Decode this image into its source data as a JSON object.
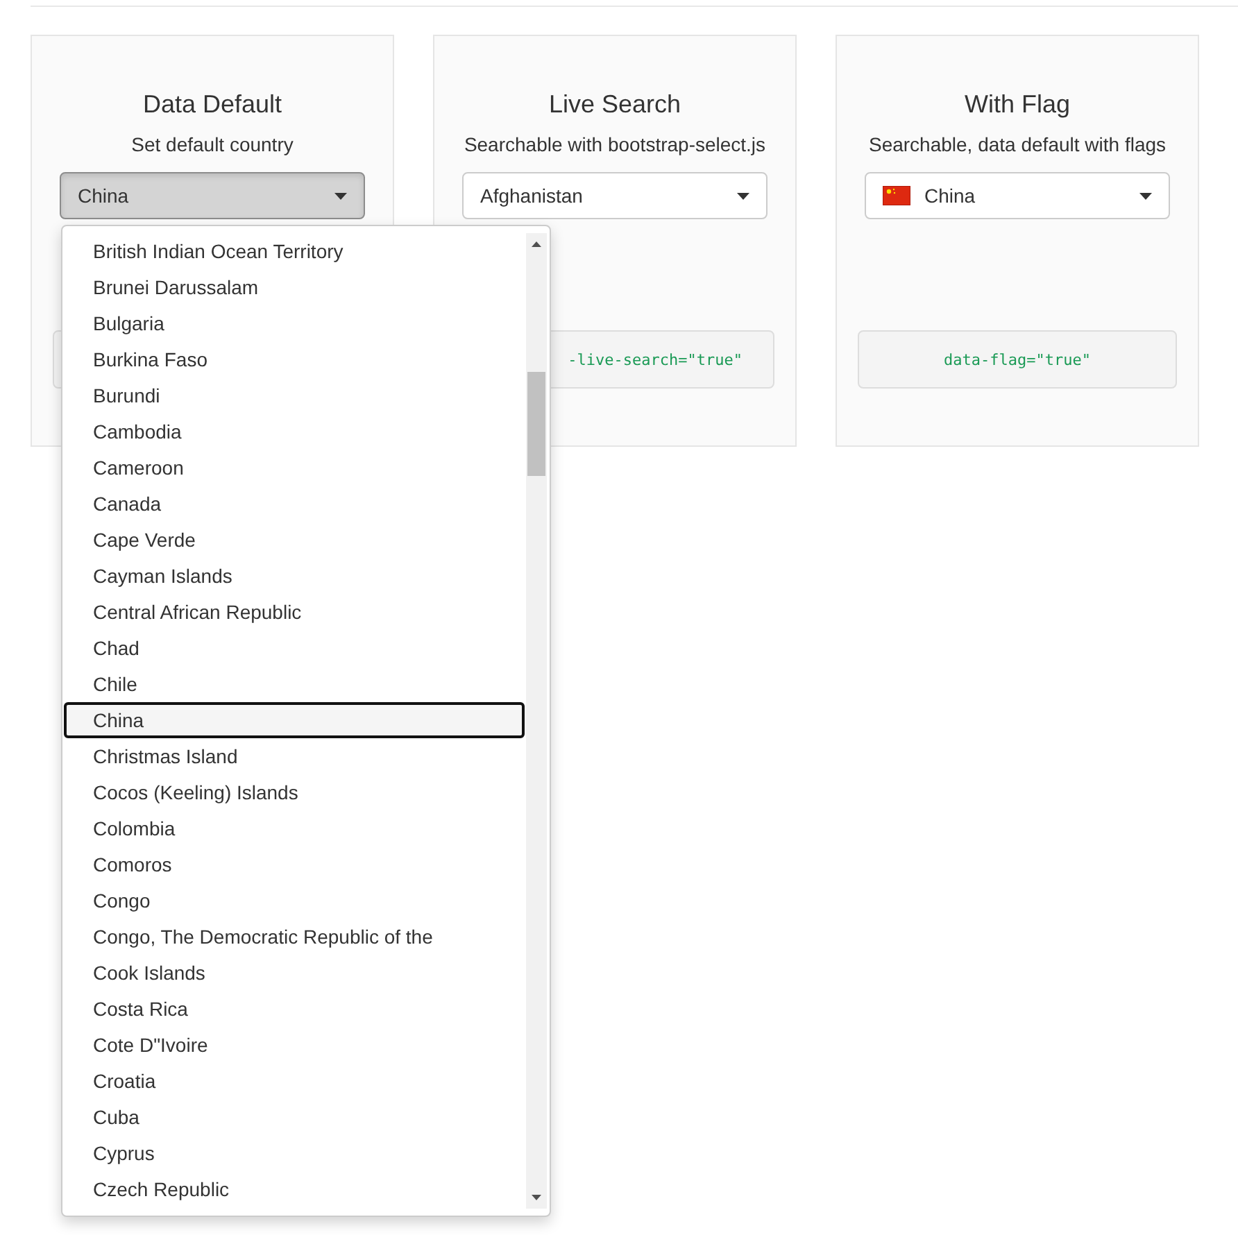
{
  "cards": [
    {
      "title": "Data Default",
      "subtitle": "Set default country",
      "select": {
        "value": "China",
        "open": true,
        "flag": false
      }
    },
    {
      "title": "Live Search",
      "subtitle": "Searchable with bootstrap-select.js",
      "select": {
        "value": "Afghanistan",
        "open": false,
        "flag": false
      },
      "code": "-live-search=\"true\""
    },
    {
      "title": "With Flag",
      "subtitle": "Searchable, data default with flags",
      "select": {
        "value": "China",
        "open": false,
        "flag": true
      },
      "code": "data-flag=\"true\""
    }
  ],
  "dropdown": {
    "items": [
      {
        "label": "British Indian Ocean Territory",
        "selected": false
      },
      {
        "label": "Brunei Darussalam",
        "selected": false
      },
      {
        "label": "Bulgaria",
        "selected": false
      },
      {
        "label": "Burkina Faso",
        "selected": false
      },
      {
        "label": "Burundi",
        "selected": false
      },
      {
        "label": "Cambodia",
        "selected": false
      },
      {
        "label": "Cameroon",
        "selected": false
      },
      {
        "label": "Canada",
        "selected": false
      },
      {
        "label": "Cape Verde",
        "selected": false
      },
      {
        "label": "Cayman Islands",
        "selected": false
      },
      {
        "label": "Central African Republic",
        "selected": false
      },
      {
        "label": "Chad",
        "selected": false
      },
      {
        "label": "Chile",
        "selected": false
      },
      {
        "label": "China",
        "selected": true
      },
      {
        "label": "Christmas Island",
        "selected": false
      },
      {
        "label": "Cocos (Keeling) Islands",
        "selected": false
      },
      {
        "label": "Colombia",
        "selected": false
      },
      {
        "label": "Comoros",
        "selected": false
      },
      {
        "label": "Congo",
        "selected": false
      },
      {
        "label": "Congo, The Democratic Republic of the",
        "selected": false
      },
      {
        "label": "Cook Islands",
        "selected": false
      },
      {
        "label": "Costa Rica",
        "selected": false
      },
      {
        "label": "Cote D\"Ivoire",
        "selected": false
      },
      {
        "label": "Croatia",
        "selected": false
      },
      {
        "label": "Cuba",
        "selected": false
      },
      {
        "label": "Cyprus",
        "selected": false
      },
      {
        "label": "Czech Republic",
        "selected": false
      }
    ]
  }
}
